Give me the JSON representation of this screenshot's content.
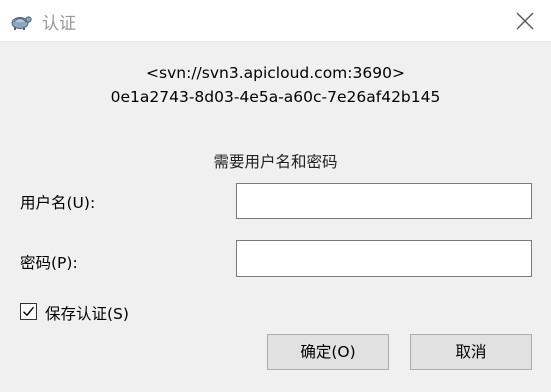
{
  "window": {
    "title": "认证",
    "app_icon": "tortoise-svn-icon",
    "close_icon": "close-icon"
  },
  "repository": {
    "url": "<svn://svn3.apicloud.com:3690>",
    "uuid": "0e1a2743-8d03-4e5a-a60c-7e26af42b145"
  },
  "prompt": "需要用户名和密码",
  "form": {
    "username_label": "用户名(U):",
    "username_value": "",
    "password_label": "密码(P):",
    "password_value": ""
  },
  "save_auth": {
    "label": "保存认证(S)",
    "checked": true
  },
  "buttons": {
    "ok_label": "确定(O)",
    "cancel_label": "取消"
  },
  "colors": {
    "title_text": "#999999",
    "titlebar_bg": "#ffffff",
    "dialog_bg": "#f0f0f0",
    "button_bg": "#e1e1e1"
  }
}
